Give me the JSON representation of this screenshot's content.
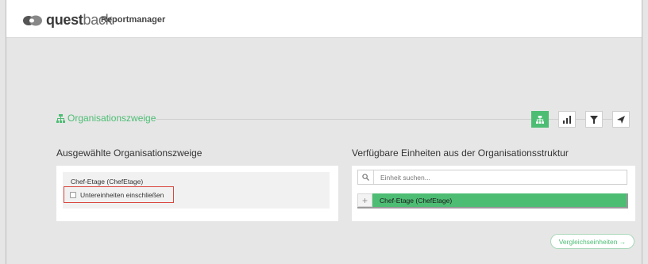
{
  "header": {
    "logo_quest": "quest",
    "logo_back": "back",
    "app_name": "Reportmanager"
  },
  "section": {
    "title": "Organisationszweige",
    "toolbar": [
      {
        "icon": "org-tree-icon",
        "active": true
      },
      {
        "icon": "chart-icon",
        "active": false
      },
      {
        "icon": "filter-icon",
        "active": false
      },
      {
        "icon": "send-icon",
        "active": false
      }
    ]
  },
  "selected": {
    "heading": "Ausgewählte Organisationszweige",
    "unit_name": "Chef-Etage (ChefEtage)",
    "include_subunits_label": "Untereinheiten einschließen",
    "include_subunits_checked": false
  },
  "available": {
    "heading": "Verfügbare Einheiten aus der Organisationsstruktur",
    "search_placeholder": "Einheit suchen...",
    "items": [
      {
        "label": "Chef-Etage (ChefEtage)"
      }
    ]
  },
  "compare_button": "Vergleichseinheiten →",
  "colors": {
    "accent": "#4dbd74",
    "highlight": "#d9473f"
  }
}
